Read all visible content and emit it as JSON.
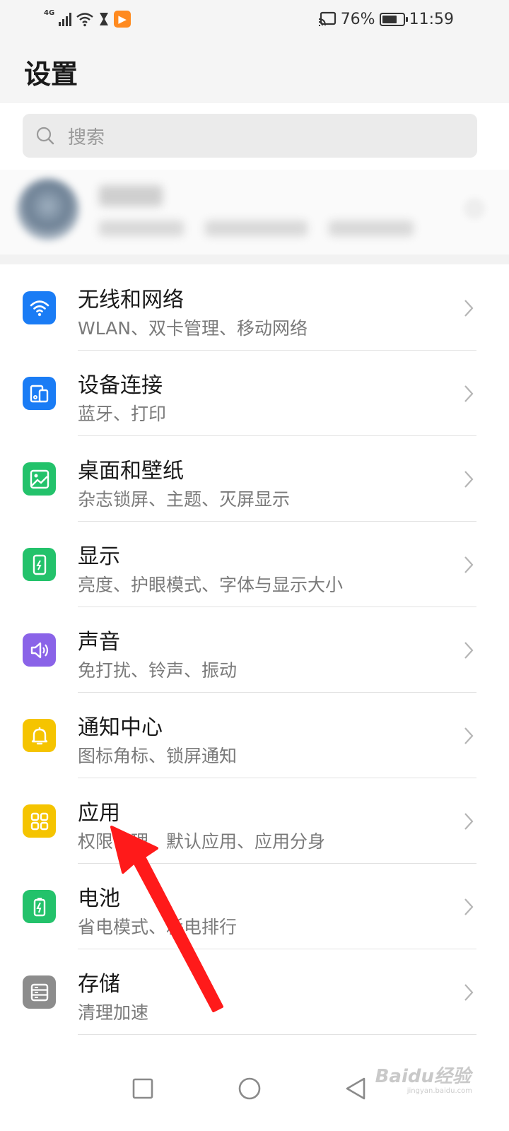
{
  "status_bar": {
    "network_label": "4G",
    "battery_percent": "76%",
    "battery_level": 0.76,
    "time": "11:59",
    "app_badge_glyph": "▶"
  },
  "header": {
    "title": "设置"
  },
  "search": {
    "placeholder": "搜索"
  },
  "settings_items": [
    {
      "title": "无线和网络",
      "subtitle": "WLAN、双卡管理、移动网络",
      "icon": "wifi-icon",
      "color": "#1a7cf5"
    },
    {
      "title": "设备连接",
      "subtitle": "蓝牙、打印",
      "icon": "device-connect-icon",
      "color": "#1a7cf5"
    },
    {
      "title": "桌面和壁纸",
      "subtitle": "杂志锁屏、主题、灭屏显示",
      "icon": "wallpaper-icon",
      "color": "#23c26b"
    },
    {
      "title": "显示",
      "subtitle": "亮度、护眼模式、字体与显示大小",
      "icon": "display-icon",
      "color": "#23c26b"
    },
    {
      "title": "声音",
      "subtitle": "免打扰、铃声、振动",
      "icon": "sound-icon",
      "color": "#8a63e8"
    },
    {
      "title": "通知中心",
      "subtitle": "图标角标、锁屏通知",
      "icon": "bell-icon",
      "color": "#f5c400"
    },
    {
      "title": "应用",
      "subtitle": "权限管理、默认应用、应用分身",
      "icon": "apps-grid-icon",
      "color": "#f5c400"
    },
    {
      "title": "电池",
      "subtitle": "省电模式、耗电排行",
      "icon": "battery-icon",
      "color": "#23c26b"
    },
    {
      "title": "存储",
      "subtitle": "清理加速",
      "icon": "storage-icon",
      "color": "#8c8c8c"
    }
  ],
  "watermark": {
    "brand": "Baidu经验",
    "url": "jingyan.baidu.com"
  },
  "colors": {
    "annotation_arrow": "#ff1a1a"
  }
}
